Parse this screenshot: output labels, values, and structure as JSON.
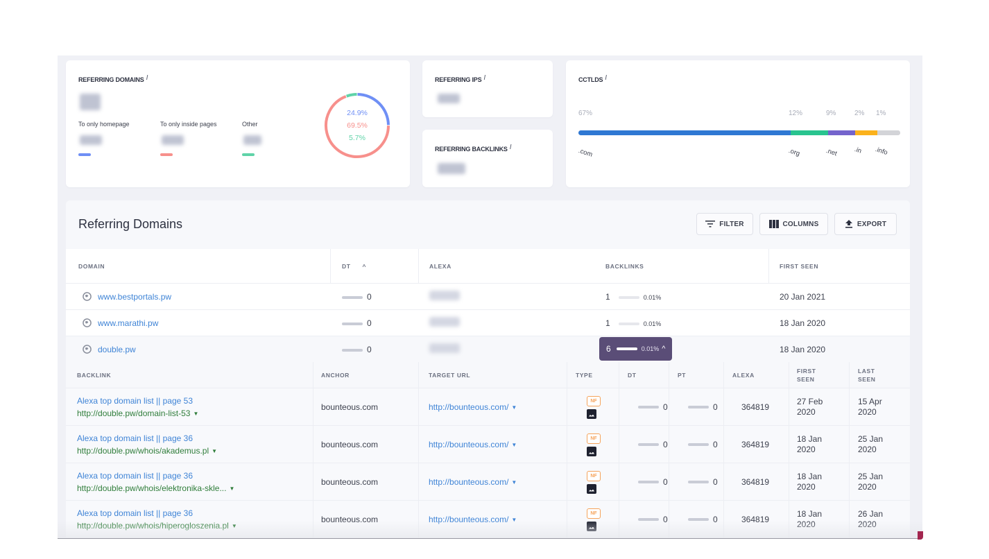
{
  "summary": {
    "referring_domains": {
      "title": "Referring Domains",
      "info_icon": "i",
      "value_hidden": true,
      "legend": [
        {
          "label": "To only homepage",
          "color": "#6f8ff5"
        },
        {
          "label": "To only inside pages",
          "color": "#f7908c"
        },
        {
          "label": "Other",
          "color": "#5fd3a8"
        }
      ],
      "donut": [
        {
          "label": "To only homepage",
          "percent": 24.9,
          "display": "24.9%",
          "color": "#6f8ff5"
        },
        {
          "label": "To only inside pages",
          "percent": 69.5,
          "display": "69.5%",
          "color": "#f7908c"
        },
        {
          "label": "Other",
          "percent": 5.7,
          "display": "5.7%",
          "color": "#5fd3a8"
        }
      ]
    },
    "referring_ips": {
      "title": "Referring IPs",
      "info_icon": "i",
      "value_hidden": true
    },
    "referring_backlinks": {
      "title": "Referring Backlinks",
      "info_icon": "i",
      "value_hidden": true
    },
    "cctlds": {
      "title": "ccTLDs",
      "info_icon": "i",
      "segments": [
        {
          "tld": ".com",
          "percent": 67,
          "display": "67%",
          "color": "#2f78d3"
        },
        {
          "tld": ".org",
          "percent": 12,
          "display": "12%",
          "color": "#29c48f"
        },
        {
          "tld": ".net",
          "percent": 9,
          "display": "9%",
          "color": "#7464cc"
        },
        {
          "tld": ".in",
          "percent": 2,
          "display": "2%",
          "color": "#fbb21c"
        },
        {
          "tld": ".info",
          "percent": 1,
          "display": "1%",
          "color": "#d3d4d8"
        }
      ]
    }
  },
  "panel": {
    "title": "Referring Domains",
    "buttons": {
      "filter": "FILTER",
      "columns": "COLUMNS",
      "export": "EXPORT"
    },
    "columns": {
      "domain": "DOMAIN",
      "dt": "DT",
      "dt_sort": "^",
      "alexa": "ALEXA",
      "backlinks": "BACKLINKS",
      "first_seen": "FIRST SEEN"
    },
    "rows": [
      {
        "domain": "www.bestportals.pw",
        "dt": "0",
        "alexa_hidden": true,
        "backlinks": "1",
        "backlinks_pct": "0.01%",
        "first_seen": "20 Jan 2021",
        "expanded": false
      },
      {
        "domain": "www.marathi.pw",
        "dt": "0",
        "alexa_hidden": true,
        "backlinks": "1",
        "backlinks_pct": "0.01%",
        "first_seen": "18 Jan 2020",
        "expanded": false
      },
      {
        "domain": "double.pw",
        "dt": "0",
        "alexa_hidden": true,
        "backlinks": "6",
        "backlinks_pct": "0.01%",
        "first_seen": "18 Jan 2020",
        "expanded": true,
        "toggle_icon": "^"
      }
    ],
    "backlinks_table": {
      "columns": {
        "backlink": "BACKLINK",
        "anchor": "ANCHOR",
        "target_url": "TARGET URL",
        "type": "TYPE",
        "dt": "DT",
        "pt": "PT",
        "alexa": "ALEXA",
        "first_seen": "FIRST SEEN",
        "last_seen": "LAST SEEN"
      },
      "rows": [
        {
          "title": "Alexa top domain list || page 53",
          "url": "http://double.pw/domain-list-53",
          "anchor": "bounteous.com",
          "target_url": "http://bounteous.com/",
          "type_badge": "NF",
          "type_icon": "image-icon",
          "dt": "0",
          "pt": "0",
          "alexa": "364819",
          "first_seen": [
            "27 Feb",
            "2020"
          ],
          "last_seen": [
            "15 Apr",
            "2020"
          ]
        },
        {
          "title": "Alexa top domain list || page 36",
          "url": "http://double.pw/whois/akademus.pl",
          "anchor": "bounteous.com",
          "target_url": "http://bounteous.com/",
          "type_badge": "NF",
          "type_icon": "image-icon",
          "dt": "0",
          "pt": "0",
          "alexa": "364819",
          "first_seen": [
            "18 Jan",
            "2020"
          ],
          "last_seen": [
            "25 Jan",
            "2020"
          ]
        },
        {
          "title": "Alexa top domain list || page 36",
          "url": "http://double.pw/whois/elektronika-skle...",
          "anchor": "bounteous.com",
          "target_url": "http://bounteous.com/",
          "type_badge": "NF",
          "type_icon": "image-icon",
          "dt": "0",
          "pt": "0",
          "alexa": "364819",
          "first_seen": [
            "18 Jan",
            "2020"
          ],
          "last_seen": [
            "25 Jan",
            "2020"
          ]
        },
        {
          "title": "Alexa top domain list || page 36",
          "url": "http://double.pw/whois/hiperogloszenia.pl",
          "anchor": "bounteous.com",
          "target_url": "http://bounteous.com/",
          "type_badge": "NF",
          "type_icon": "image-icon",
          "dt": "0",
          "pt": "0",
          "alexa": "364819",
          "first_seen": [
            "18 Jan",
            "2020"
          ],
          "last_seen": [
            "26 Jan",
            "2020"
          ]
        }
      ]
    }
  }
}
